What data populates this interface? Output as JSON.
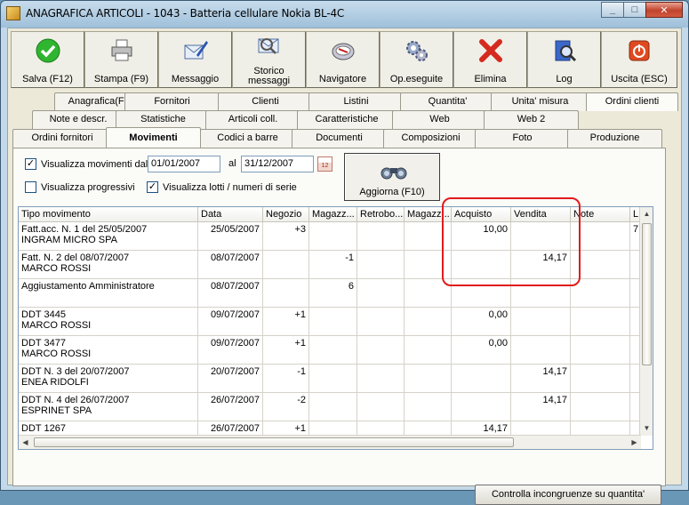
{
  "window": {
    "title": "ANAGRAFICA ARTICOLI - 1043 - Batteria cellulare Nokia BL-4C",
    "minimize": "_",
    "maximize": "□",
    "close": "✕"
  },
  "toolbar": [
    {
      "label": "Salva (F12)",
      "icon": "checkmark-icon"
    },
    {
      "label": "Stampa (F9)",
      "icon": "printer-icon"
    },
    {
      "label": "Messaggio",
      "icon": "message-pen-icon"
    },
    {
      "label": "Storico\nmessaggi",
      "icon": "message-history-icon"
    },
    {
      "label": "Navigatore",
      "icon": "navigator-icon"
    },
    {
      "label": "Op.eseguite",
      "icon": "gears-icon"
    },
    {
      "label": "Elimina",
      "icon": "delete-x-icon"
    },
    {
      "label": "Log",
      "icon": "log-book-icon"
    },
    {
      "label": "Uscita (ESC)",
      "icon": "exit-icon"
    }
  ],
  "tabs": {
    "row1": [
      "Anagrafica(F5)",
      "Fornitori",
      "Clienti",
      "Listini",
      "Quantita'",
      "Unita' misura",
      "Ordini clienti"
    ],
    "row2": [
      "Note e descr.",
      "Statistiche",
      "Articoli coll.",
      "Caratteristiche",
      "Web",
      "Web 2"
    ],
    "row3": [
      "Ordini fornitori",
      "Movimenti",
      "Codici a barre",
      "Documenti",
      "Composizioni",
      "Foto",
      "Produzione"
    ],
    "active": "Movimenti"
  },
  "filters": {
    "show_movements_label": "Visualizza movimenti dal",
    "show_movements_checked": "✓",
    "date_from": "01/01/2007",
    "al_label": "al",
    "date_to": "31/12/2007",
    "calendar_label": "12",
    "show_progressive_label": "Visualizza progressivi",
    "show_lots_label": "Visualizza lotti /  numeri di serie",
    "show_lots_checked": "✓",
    "refresh_button": "Aggiorna (F10)"
  },
  "grid": {
    "columns": [
      "Tipo movimento",
      "Data",
      "Negozio",
      "Magazz...",
      "Retrobo...",
      "Magazz...",
      "Acquisto",
      "Vendita",
      "Note",
      "L"
    ],
    "rows": [
      [
        "Fatt.acc. N. 1 del 25/05/2007\nINGRAM MICRO SPA",
        "25/05/2007",
        "+3",
        "",
        "",
        "",
        "10,00",
        "",
        "",
        "7"
      ],
      [
        "Fatt. N. 2 del 08/07/2007\nMARCO ROSSI",
        "08/07/2007",
        "",
        "-1",
        "",
        "",
        "",
        "14,17",
        "",
        ""
      ],
      [
        "Aggiustamento Amministratore",
        "08/07/2007",
        "",
        "6",
        "",
        "",
        "",
        "",
        "",
        ""
      ],
      [
        "DDT 3445\nMARCO ROSSI",
        "09/07/2007",
        "+1",
        "",
        "",
        "",
        "0,00",
        "",
        "",
        ""
      ],
      [
        "DDT 3477\nMARCO ROSSI",
        "09/07/2007",
        "+1",
        "",
        "",
        "",
        "0,00",
        "",
        "",
        ""
      ],
      [
        "DDT N. 3 del 20/07/2007\nENEA RIDOLFI",
        "20/07/2007",
        "-1",
        "",
        "",
        "",
        "",
        "14,17",
        "",
        ""
      ],
      [
        "DDT N. 4 del 26/07/2007\nESPRINET SPA",
        "26/07/2007",
        "-2",
        "",
        "",
        "",
        "",
        "14,17",
        "",
        ""
      ],
      [
        "DDT 1267",
        "26/07/2007",
        "+1",
        "",
        "",
        "",
        "14,17",
        "",
        "",
        ""
      ]
    ]
  },
  "bottom_button": "Controlla incongruenze su quantita'"
}
